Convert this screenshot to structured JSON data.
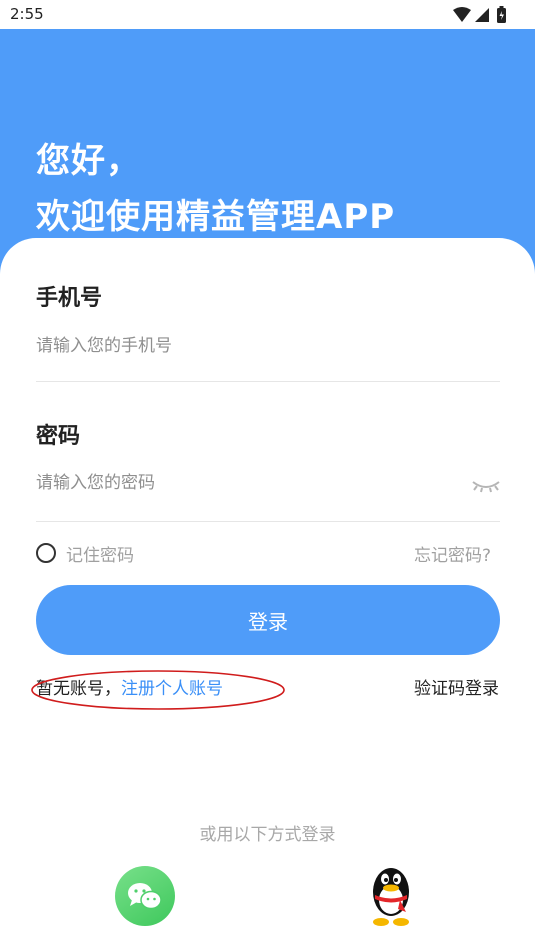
{
  "status_bar": {
    "time": "2:55",
    "icons": [
      "wifi-icon",
      "signal-icon",
      "battery-icon"
    ]
  },
  "header": {
    "greeting_line1": "您好，",
    "greeting_line2": "欢迎使用精益管理APP"
  },
  "form": {
    "phone": {
      "label": "手机号",
      "placeholder": "请输入您的手机号",
      "value": ""
    },
    "password": {
      "label": "密码",
      "placeholder": "请输入您的密码",
      "value": ""
    },
    "remember_label": "记住密码",
    "forgot_label": "忘记密码?",
    "login_button": "登录"
  },
  "register": {
    "prefix": "暂无账号，",
    "link": "注册个人账号"
  },
  "sms_login": "验证码登录",
  "other_login": {
    "caption": "或用以下方式登录",
    "options": [
      "wechat-icon",
      "qq-icon"
    ]
  },
  "colors": {
    "primary": "#4f9cf9",
    "link": "#3a8ff7",
    "annotation": "#d01c1c"
  }
}
